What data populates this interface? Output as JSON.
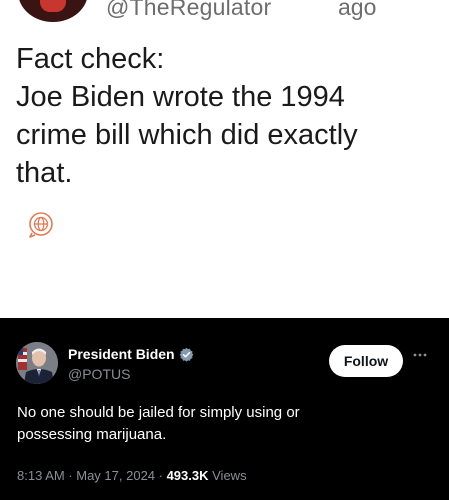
{
  "header": {
    "handle": "@TheRegulator",
    "time": "ago"
  },
  "post": {
    "lines": [
      "Fact check:",
      "Joe Biden wrote the 1994",
      "crime bill which did exactly",
      "that."
    ],
    "translate_icon": "globe-icon"
  },
  "quoted_tweet": {
    "name": "President Biden",
    "verified_icon": "verified-badge-icon",
    "handle": "@POTUS",
    "follow_label": "Follow",
    "more_icon": "more-dots-icon",
    "text_lines": [
      "No one should be jailed for simply using or",
      "possessing marijuana."
    ],
    "timestamp": "8:13 AM · May 17, 2024 · ",
    "views_count": "493.3K",
    "views_label": "Views",
    "colors": {
      "background": "#000000",
      "verified": "#829aab",
      "muted": "#8a8f94"
    }
  }
}
